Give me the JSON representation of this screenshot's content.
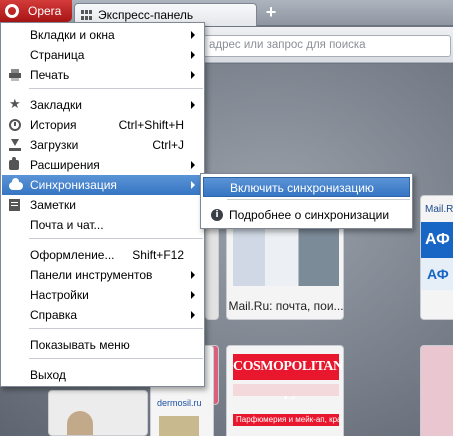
{
  "browser": {
    "app_button_label": "Opera",
    "tab_title": "Экспресс-панель",
    "new_tab_glyph": "+",
    "address_placeholder": "адрес или запрос для поиска"
  },
  "speed_dial": {
    "mail_caption": "Mail.Ru: почта, пои...",
    "cosmo_logo": "COSMOPOLITAN Форум",
    "cosmo_banner": "Парфюмерия и мейк-ап, красота (подборки)",
    "right_site_label": "Mail.Ru",
    "right_logo_text": "АФ",
    "right_logo_text_2": "АФ",
    "left_site_label": "dermosil.ru"
  },
  "menu": {
    "items": [
      {
        "label": "Вкладки и окна",
        "has_submenu": true,
        "icon": ""
      },
      {
        "label": "Страница",
        "has_submenu": true,
        "icon": ""
      },
      {
        "label": "Печать",
        "has_submenu": true,
        "icon": "printer-icon"
      },
      {
        "label": "Закладки",
        "has_submenu": true,
        "icon": "star-icon"
      },
      {
        "label": "История",
        "shortcut": "Ctrl+Shift+H",
        "icon": "clock-icon"
      },
      {
        "label": "Загрузки",
        "shortcut": "Ctrl+J",
        "icon": "download-icon"
      },
      {
        "label": "Расширения",
        "has_submenu": true,
        "icon": "puzzle-icon"
      },
      {
        "label": "Синхронизация",
        "has_submenu": true,
        "icon": "cloud-icon",
        "active": true
      },
      {
        "label": "Заметки",
        "icon": "note-icon"
      },
      {
        "label": "Почта и чат...",
        "icon": ""
      },
      {
        "label": "Оформление...",
        "shortcut": "Shift+F12",
        "icon": ""
      },
      {
        "label": "Панели инструментов",
        "has_submenu": true,
        "icon": ""
      },
      {
        "label": "Настройки",
        "has_submenu": true,
        "icon": ""
      },
      {
        "label": "Справка",
        "has_submenu": true,
        "icon": ""
      },
      {
        "label": "Показывать меню",
        "icon": ""
      },
      {
        "label": "Выход",
        "icon": ""
      }
    ]
  },
  "submenu": {
    "items": [
      {
        "label": "Включить синхронизацию",
        "active": true
      },
      {
        "label": "Подробнее о синхронизации",
        "icon": "info-icon"
      }
    ],
    "info_glyph": "i"
  },
  "colors": {
    "opera_red": "#c42222",
    "highlight": "#3d7bc8"
  }
}
